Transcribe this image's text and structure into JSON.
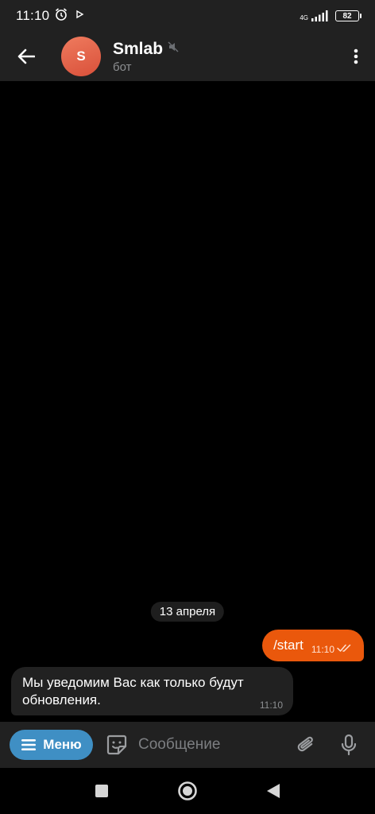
{
  "status_bar": {
    "time": "11:10",
    "network": "4G",
    "battery": "82"
  },
  "header": {
    "avatar_letter": "S",
    "title": "Smlab",
    "subtitle": "бот"
  },
  "chat": {
    "date_separator": "13 апреля",
    "outgoing": {
      "text": "/start",
      "time": "11:10"
    },
    "incoming": {
      "text": "Мы уведомим Вас как только будут обновления.",
      "time": "11:10"
    }
  },
  "composer": {
    "menu_label": "Меню",
    "placeholder": "Сообщение"
  },
  "colors": {
    "accent_outgoing": "#ea580c",
    "menu_button": "#3f8fc4",
    "avatar": "#e1614a"
  }
}
